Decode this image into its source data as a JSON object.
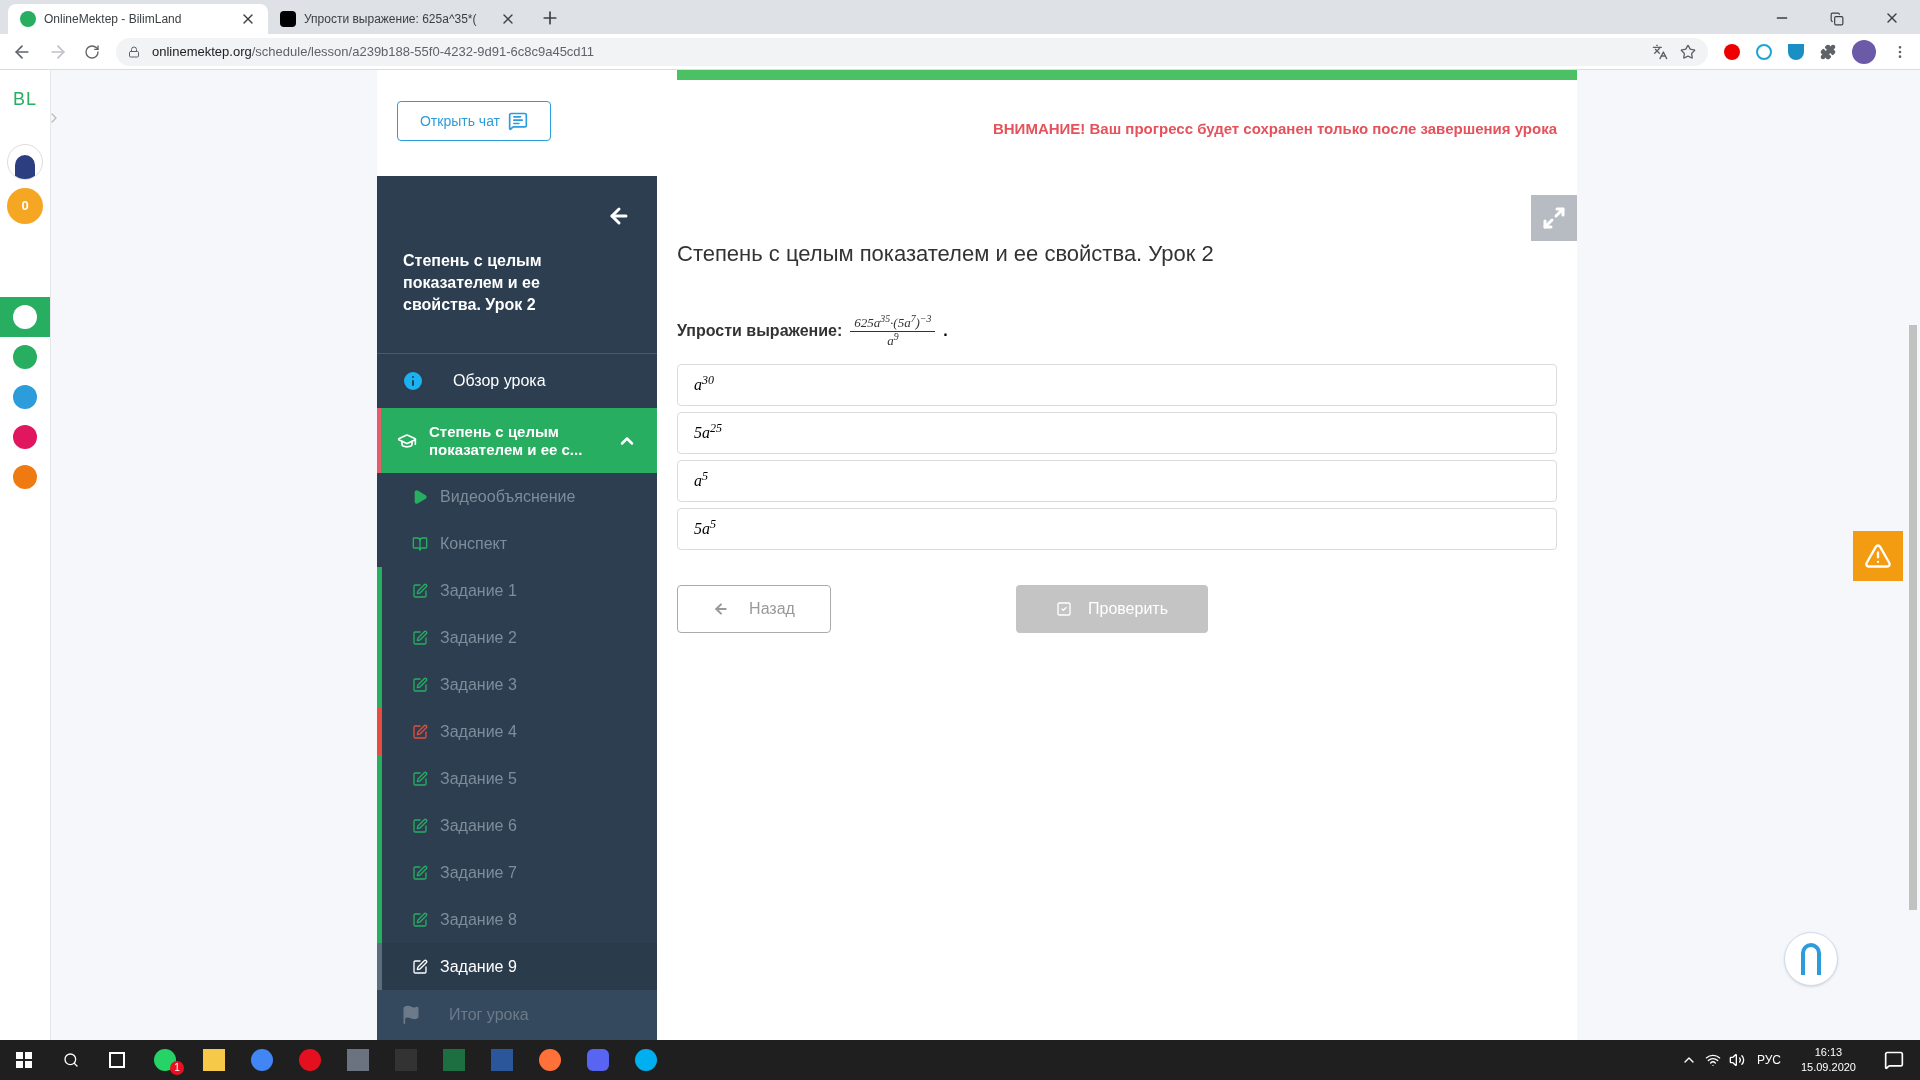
{
  "browser": {
    "tabs": [
      {
        "title": "OnlineMektep - BilimLand",
        "selected": true
      },
      {
        "title": "Упрости выражение: 625a^35*(",
        "selected": false
      }
    ],
    "url_host": "onlinemektep.org",
    "url_path": "/schedule/lesson/a239b188-55f0-4232-9d91-6c8c9a45cd11"
  },
  "rail": {
    "logo": "BL",
    "coins": "0",
    "apps": [
      {
        "selected": true,
        "color": "#ffffff"
      },
      {
        "selected": false,
        "color": "#27ae60"
      },
      {
        "selected": false,
        "color": "#2d9cdb"
      },
      {
        "selected": false,
        "color": "#e0165e"
      },
      {
        "selected": false,
        "color": "#f07a12"
      }
    ]
  },
  "chat_button": "Открыть чат",
  "progress": {
    "level": 1
  },
  "warning": "ВНИМАНИЕ! Ваш прогресс будет сохранен только после завершения урока",
  "sidebar": {
    "title": "Степень с целым показателем и ее свойства. Урок 2",
    "overview": "Обзор урока",
    "section": {
      "title": "Степень с целым показателем и ее с...",
      "expanded": true,
      "items": [
        {
          "kind": "video",
          "label": "Видеообъяснение",
          "selected": false
        },
        {
          "kind": "notes",
          "label": "Конспект",
          "selected": false
        },
        {
          "kind": "task",
          "label": "Задание 1",
          "color": "#27ae60",
          "selected": false
        },
        {
          "kind": "task",
          "label": "Задание 2",
          "color": "#27ae60",
          "selected": false
        },
        {
          "kind": "task",
          "label": "Задание 3",
          "color": "#27ae60",
          "selected": false
        },
        {
          "kind": "task",
          "label": "Задание 4",
          "color": "#e74c3c",
          "selected": false
        },
        {
          "kind": "task",
          "label": "Задание 5",
          "color": "#27ae60",
          "selected": false
        },
        {
          "kind": "task",
          "label": "Задание 6",
          "color": "#27ae60",
          "selected": false
        },
        {
          "kind": "task",
          "label": "Задание 7",
          "color": "#27ae60",
          "selected": false
        },
        {
          "kind": "task",
          "label": "Задание 8",
          "color": "#27ae60",
          "selected": false
        },
        {
          "kind": "task",
          "label": "Задание 9",
          "color": "#5d6d7e",
          "selected": true
        }
      ]
    },
    "summary": {
      "label": "Итог урока",
      "disabled": true
    }
  },
  "lesson_title": "Степень с целым показателем и ее свойства. Урок 2",
  "question": {
    "label": "Упрости выражение:",
    "numerator": "625a$^{35}$·(5a$^{7}$)$^{−3}$",
    "denominator": "a$^{9}$",
    "end": "."
  },
  "options": [
    {
      "text": "a$^{30}$",
      "selected": false
    },
    {
      "text": "5a$^{25}$",
      "selected": false
    },
    {
      "text": "a$^{5}$",
      "selected": false
    },
    {
      "text": "5a$^{5}$",
      "selected": false
    }
  ],
  "back_button": "Назад",
  "check_button": {
    "label": "Проверить",
    "disabled": true
  },
  "taskbar": {
    "whatsapp_badge": "1",
    "language": "РУС",
    "time": "16:13",
    "date": "15.09.2020"
  }
}
